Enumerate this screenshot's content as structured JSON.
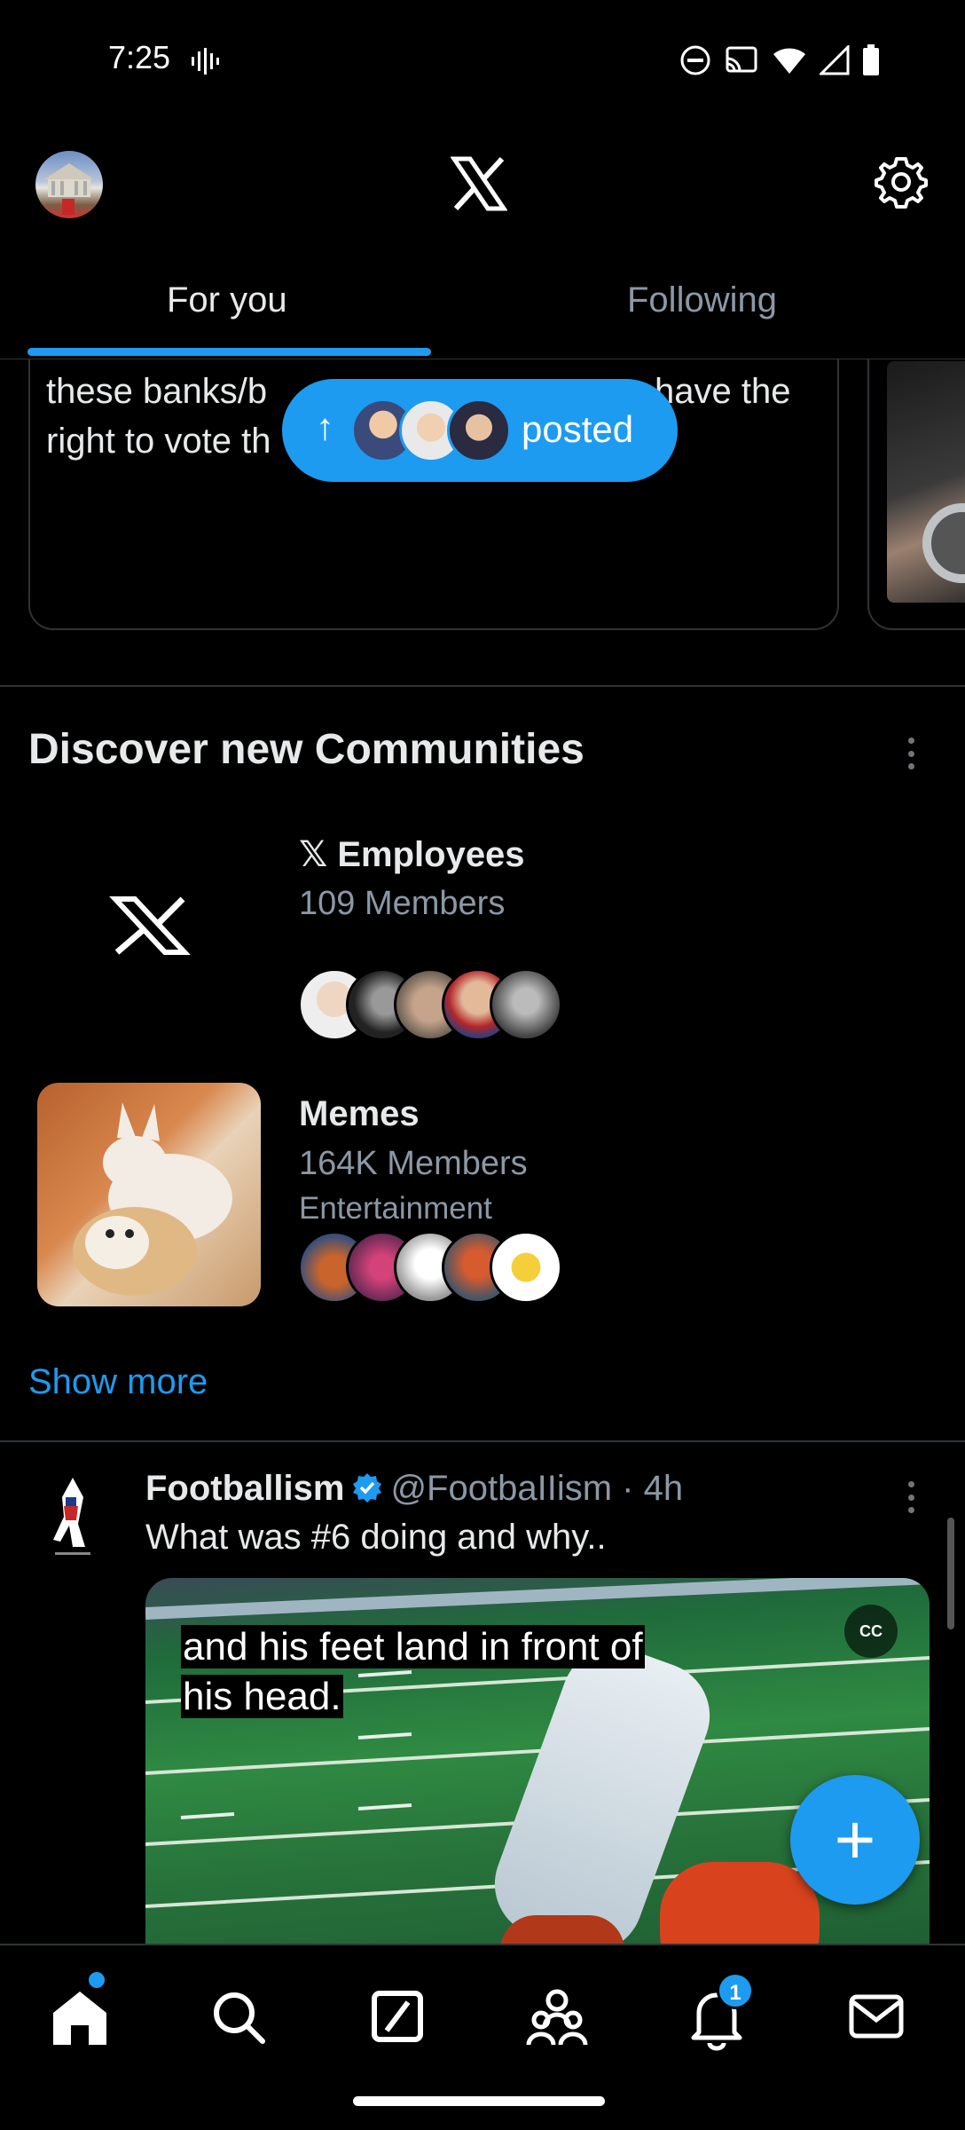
{
  "status_bar": {
    "time": "7:25"
  },
  "header": {
    "tabs": [
      {
        "label": "For you",
        "active": true
      },
      {
        "label": "Following",
        "active": false
      }
    ]
  },
  "feed": {
    "card_text": "these banks/b… have the right to vote th…",
    "card_text_line1_left": "these banks/b",
    "card_text_line1_right": "have the",
    "card_text_line2": "right to vote th",
    "new_posts_pill": {
      "label": "posted",
      "arrow": "↑"
    }
  },
  "communities": {
    "title": "Discover new Communities",
    "items": [
      {
        "name": "𝕏 Employees",
        "members": "109 Members",
        "category": ""
      },
      {
        "name": "Memes",
        "members": "164K Members",
        "category": "Entertainment"
      }
    ],
    "show_more": "Show more"
  },
  "tweet": {
    "name": "Footballism",
    "handle": "@FootbaIIism",
    "time": "4h",
    "separator": "·",
    "text": "What was #6 doing and why..",
    "caption_line1": "and his feet land in front of",
    "caption_line2": "his head.",
    "cc": "CC"
  },
  "fab": {
    "label": "+"
  },
  "bottom_nav": {
    "notifications_badge": "1"
  },
  "colors": {
    "accent": "#1d9bf0",
    "background": "#000000",
    "text_primary": "#e7e9ea",
    "text_secondary": "#8b98a5"
  }
}
